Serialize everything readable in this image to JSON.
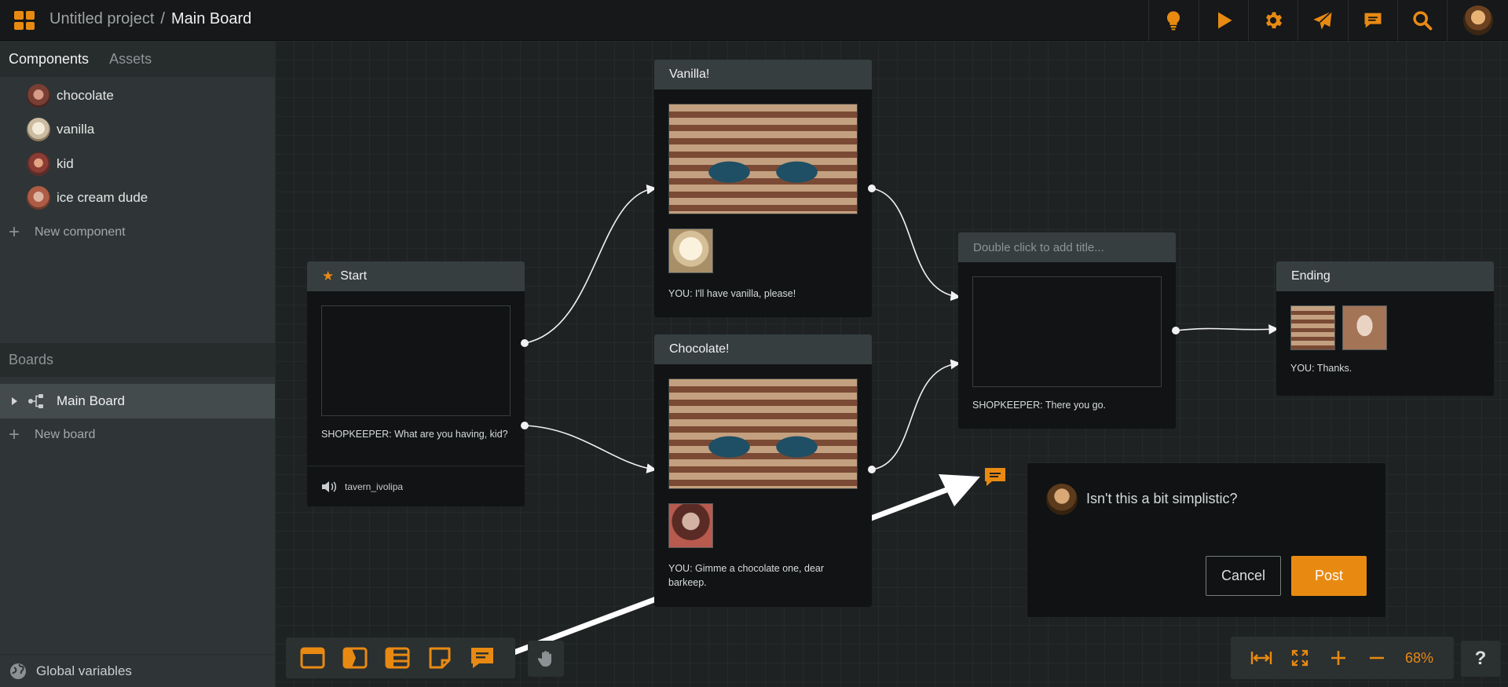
{
  "header": {
    "project_name": "Untitled project",
    "separator": "/",
    "board_name": "Main Board",
    "tools": [
      {
        "icon": "lightbulb-icon"
      },
      {
        "icon": "play-icon"
      },
      {
        "icon": "gear-icon"
      },
      {
        "icon": "send-icon"
      },
      {
        "icon": "comment-icon"
      },
      {
        "icon": "search-icon"
      }
    ],
    "accent": "#e88a12"
  },
  "sidebar": {
    "tabs": [
      "Components",
      "Assets"
    ],
    "components": [
      {
        "label": "chocolate"
      },
      {
        "label": "vanilla"
      },
      {
        "label": "kid"
      },
      {
        "label": "ice cream dude"
      }
    ],
    "new_component": "New component",
    "boards_title": "Boards",
    "boards": [
      {
        "label": "Main Board"
      }
    ],
    "new_board": "New board",
    "global_variables": "Global variables"
  },
  "nodes": {
    "start": {
      "title": "Start",
      "text": "SHOPKEEPER: What are you having, kid?",
      "audio": "tavern_ivolipa"
    },
    "vanilla": {
      "title": "Vanilla!",
      "text": "YOU: I'll have vanilla, please!"
    },
    "chocolate": {
      "title": "Chocolate!",
      "text": "YOU: Gimme a chocolate one, dear barkeep."
    },
    "untitled": {
      "title_placeholder": "Double click to add title...",
      "text": "SHOPKEEPER: There you go."
    },
    "ending": {
      "title": "Ending",
      "text": "YOU: Thanks."
    }
  },
  "comment": {
    "value": "Isn't this a bit simplistic?",
    "cancel": "Cancel",
    "post": "Post"
  },
  "zoom": {
    "level": "68%"
  },
  "help": "?"
}
